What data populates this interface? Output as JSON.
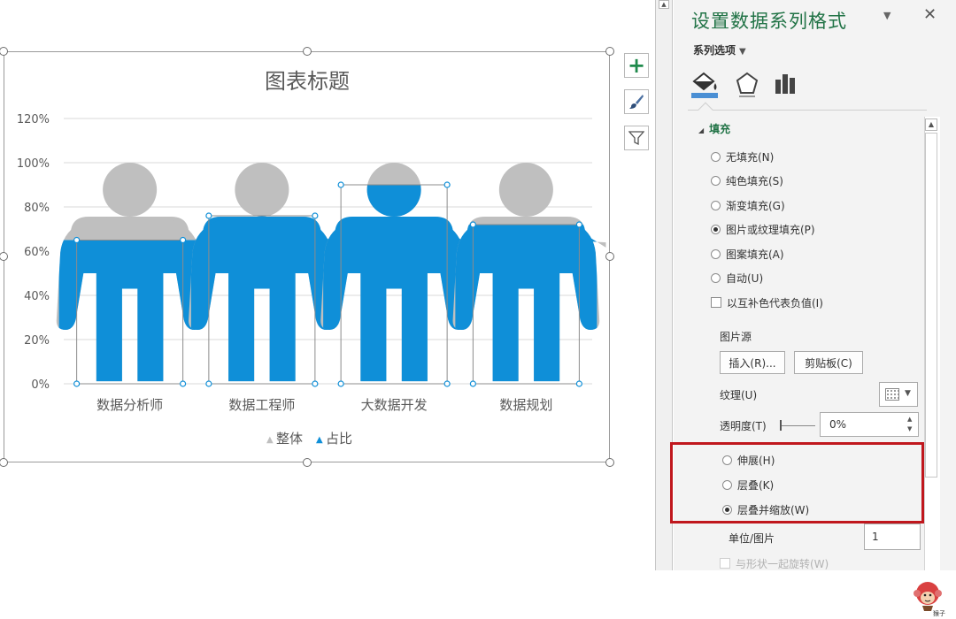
{
  "chart": {
    "title": "图表标题",
    "y_ticks": [
      "0%",
      "20%",
      "40%",
      "60%",
      "80%",
      "100%",
      "120%"
    ],
    "legend": [
      {
        "label": "整体",
        "color": "#bfbfbf"
      },
      {
        "label": "占比",
        "color": "#0f8fd8"
      }
    ]
  },
  "chart_data": {
    "type": "bar",
    "title": "图表标题",
    "categories": [
      "数据分析师",
      "数据工程师",
      "大数据开发",
      "数据规划"
    ],
    "series": [
      {
        "name": "整体",
        "values": [
          1.0,
          1.0,
          1.0,
          1.0
        ]
      },
      {
        "name": "占比",
        "values": [
          0.65,
          0.76,
          0.9,
          0.72
        ]
      }
    ],
    "ylim": [
      0,
      1.2
    ],
    "y_tick_values": [
      0,
      0.2,
      0.4,
      0.6,
      0.8,
      1.0,
      1.2
    ],
    "grid": true,
    "legend": "bottom",
    "colors": {
      "overall": "#bfbfbf",
      "ratio": "#0f8fd8"
    }
  },
  "side_buttons": {
    "add": "+",
    "brush": "brush-icon",
    "filter": "filter-icon"
  },
  "pane": {
    "title": "设置数据系列格式",
    "series_options": "系列选项",
    "section_fill": "填充",
    "fill_options": [
      {
        "label": "无填充(N)",
        "checked": false
      },
      {
        "label": "纯色填充(S)",
        "checked": false
      },
      {
        "label": "渐变填充(G)",
        "checked": false
      },
      {
        "label": "图片或纹理填充(P)",
        "checked": true
      },
      {
        "label": "图案填充(A)",
        "checked": false
      },
      {
        "label": "自动(U)",
        "checked": false
      }
    ],
    "invert_negative": "以互补色代表负值(I)",
    "picture_source": "图片源",
    "insert_button": "插入(R)...",
    "clipboard_button": "剪贴板(C)",
    "texture_label": "纹理(U)",
    "transparency_label": "透明度(T)",
    "transparency_value": "0%",
    "stack_options": [
      {
        "label": "伸展(H)",
        "checked": false
      },
      {
        "label": "层叠(K)",
        "checked": false
      },
      {
        "label": "层叠并缩放(W)",
        "checked": true
      }
    ],
    "unit_label": "单位/图片",
    "unit_value": "1",
    "rotate_label": "与形状一起旋转(W)"
  },
  "logo": {
    "text": "猴子"
  }
}
